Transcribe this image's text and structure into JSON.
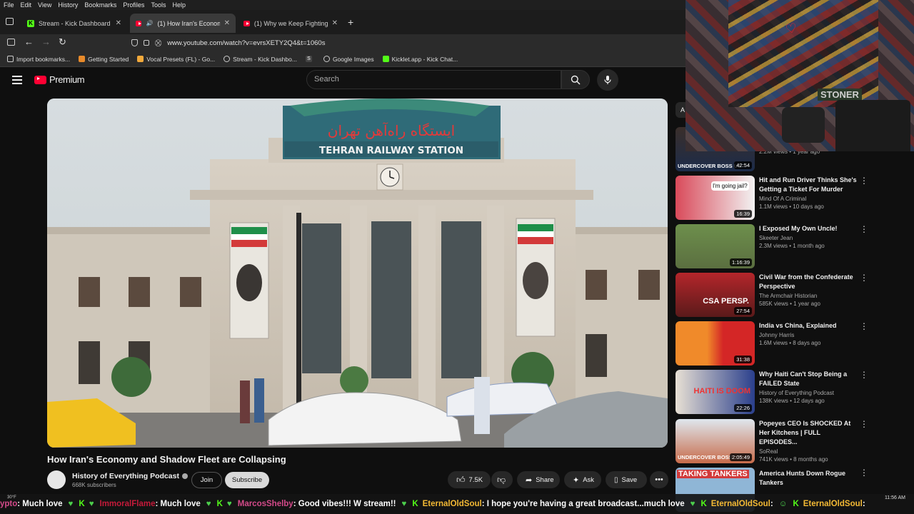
{
  "menubar": [
    "File",
    "Edit",
    "View",
    "History",
    "Bookmarks",
    "Profiles",
    "Tools",
    "Help"
  ],
  "tabs": [
    {
      "title": "Stream - Kick Dashboard",
      "active": false,
      "icon": "kick-icon"
    },
    {
      "title": "(1) How Iran's Economy and",
      "active": true,
      "icon": "youtube-icon"
    },
    {
      "title": "(1) Why we Keep Fighting Stupi",
      "active": false,
      "icon": "youtube-icon"
    }
  ],
  "address": "www.youtube.com/watch?v=evrsXETY2Q4&t=1060s",
  "bookmarks": [
    "Import bookmarks...",
    "Getting Started",
    "Vocal Presets (FL) - Go...",
    "Stream - Kick Dashbo...",
    "",
    "Google Images",
    "Kicklet.app - Kick Chat..."
  ],
  "youtube": {
    "logo": "Premium",
    "search_placeholder": "Search"
  },
  "video": {
    "sign_persian": "ایستگاه راه‌آهن تهران",
    "sign_english": "TEHRAN RAILWAY STATION",
    "title": "How Iran's Economy and Shadow Fleet are Collapsing",
    "channel": "History of Everything Podcast",
    "subscribers": "668K subscribers",
    "join": "Join",
    "subscribe": "Subscribe",
    "likes": "7.5K",
    "share": "Share",
    "ask": "Ask",
    "save": "Save"
  },
  "recommendations": [
    {
      "title": "",
      "channel": "",
      "meta": "2.2M views • 1 year ago",
      "duration": "42:54",
      "thumb_text": "UNDERCOVER BOSS US"
    },
    {
      "title": "Hit and Run Driver Thinks She's Getting a Ticket For Murder",
      "channel": "Mind Of A Criminal",
      "meta": "1.1M views • 10 days ago",
      "duration": "16:39",
      "thumb_text": "I'm going jail?"
    },
    {
      "title": "I Exposed My Own Uncle!",
      "channel": "Skeeter Jean",
      "meta": "2.3M views • 1 month ago",
      "duration": "1:16:39",
      "thumb_text": ""
    },
    {
      "title": "Civil War from the Confederate Perspective",
      "channel": "The Armchair Historian",
      "meta": "585K views • 1 year ago",
      "duration": "27:54",
      "thumb_text": "CSA PERSP."
    },
    {
      "title": "India vs China, Explained",
      "channel": "Johnny Harris",
      "meta": "1.6M views • 8 days ago",
      "duration": "31:38",
      "thumb_text": ""
    },
    {
      "title": "Why Haiti Can't Stop Being a FAILED State",
      "channel": "History of Everything Podcast",
      "meta": "138K views • 12 days ago",
      "duration": "22:26",
      "thumb_text": "HAITI IS DOOM"
    },
    {
      "title": "Popeyes CEO Is SHOCKED At Her Kitchens | FULL EPISODES...",
      "channel": "SoReal",
      "meta": "741K views • 8 months ago",
      "duration": "2:05:49",
      "thumb_text": "UNDERCOVER BOSS"
    },
    {
      "title": "America Hunts Down Rogue Tankers",
      "channel": "",
      "meta": "",
      "duration": "",
      "thumb_text": "TAKING TANKERS"
    }
  ],
  "ticker": {
    "entries": [
      {
        "user": "ypto",
        "msg": ": Much love"
      },
      {
        "user": "ImmoralFlame",
        "msg": ": Much love"
      },
      {
        "user": "MarcosShelby",
        "msg": ": Good vibes!!! W stream!!"
      },
      {
        "user": "EternalOldSoul",
        "msg": ": I hope you're having a great broadcast...much love"
      },
      {
        "user": "EternalOldSoul",
        "msg": ":"
      },
      {
        "user": "EternalOldSoul",
        "msg": ":"
      }
    ],
    "weather": "30°F",
    "clock": "11:56 AM"
  },
  "webcam": {
    "caption": "STONER"
  },
  "colors": {
    "kick_green": "#53fc18",
    "youtube_red": "#ff0033",
    "bg": "#0f0f0f"
  }
}
